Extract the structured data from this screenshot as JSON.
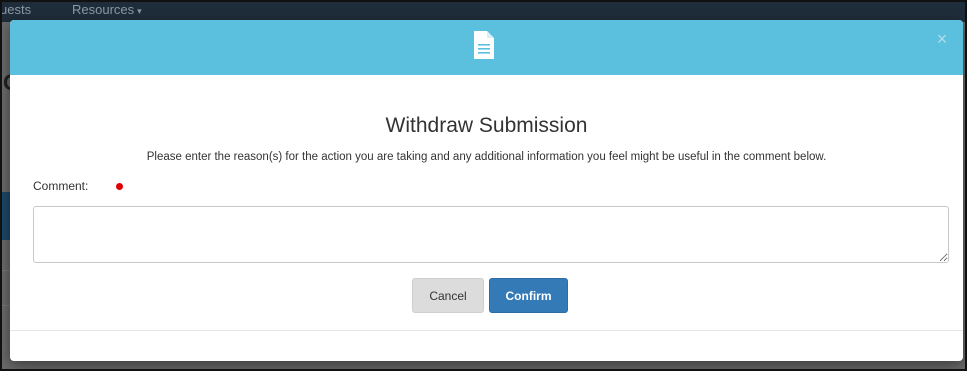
{
  "background_page": {
    "nav_left_text": "uests",
    "nav_resources_label": "Resources",
    "nav_caret": "▾",
    "glyph": "C"
  },
  "modal": {
    "header_color": "#5bc0de",
    "header_icon": "document-icon",
    "close_symbol": "×",
    "title": "Withdraw Submission",
    "description": "Please enter the reason(s) for the action you are taking and any additional information you feel might be useful in the comment below.",
    "comment_label": "Comment:",
    "comment_value": "",
    "required_color": "#e00000",
    "cancel_label": "Cancel",
    "confirm_label": "Confirm",
    "confirm_color": "#337ab7"
  }
}
